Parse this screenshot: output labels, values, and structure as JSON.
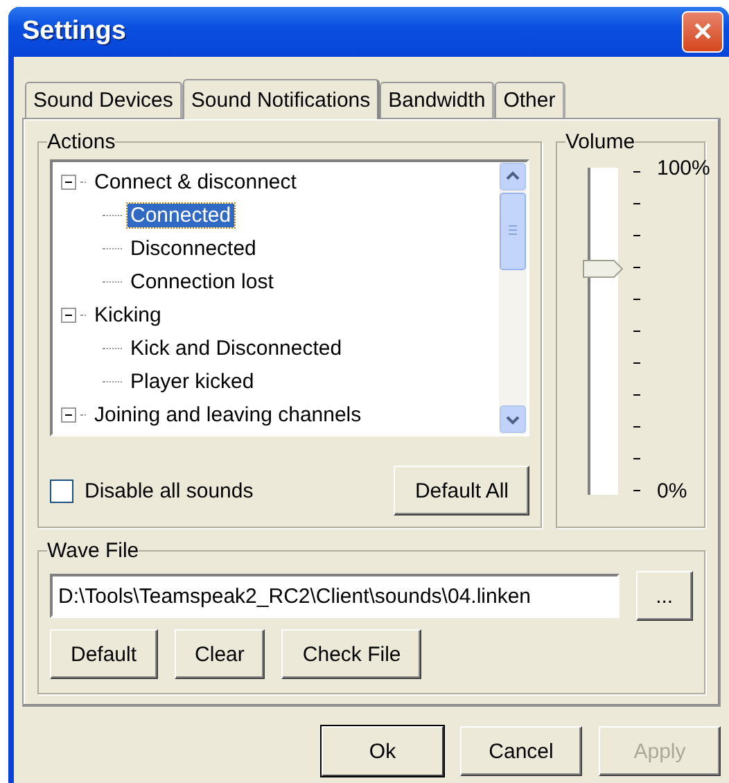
{
  "window": {
    "title": "Settings",
    "close_label": "✕"
  },
  "tabs": [
    {
      "label": "Sound Devices",
      "selected": false
    },
    {
      "label": "Sound Notifications",
      "selected": true
    },
    {
      "label": "Bandwidth",
      "selected": false
    },
    {
      "label": "Other",
      "selected": false
    }
  ],
  "actions": {
    "title": "Actions",
    "tree": [
      {
        "label": "Connect & disconnect",
        "expanded": true,
        "selected": false,
        "children": [
          {
            "label": "Connected",
            "selected": true
          },
          {
            "label": "Disconnected",
            "selected": false
          },
          {
            "label": "Connection lost",
            "selected": false
          }
        ]
      },
      {
        "label": "Kicking",
        "expanded": true,
        "selected": false,
        "children": [
          {
            "label": "Kick and Disconnected",
            "selected": false
          },
          {
            "label": "Player kicked",
            "selected": false
          }
        ]
      },
      {
        "label": "Joining and leaving  channels",
        "expanded": true,
        "selected": false
      }
    ],
    "disable_all": {
      "label": "Disable all sounds",
      "checked": false
    },
    "default_all_button": "Default All"
  },
  "volume": {
    "title": "Volume",
    "level": 0.7,
    "max_label": "100%",
    "min_label": "0%"
  },
  "wave_file": {
    "title": "Wave File",
    "value": "D:\\Tools\\Teamspeak2_RC2\\Client\\sounds\\04.linken",
    "browse_button": "...",
    "buttons": [
      "Default",
      "Clear",
      "Check File"
    ]
  },
  "footer_buttons": [
    {
      "label": "Ok",
      "default": true,
      "disabled": false
    },
    {
      "label": "Cancel",
      "default": false,
      "disabled": false
    },
    {
      "label": "Apply",
      "default": false,
      "disabled": true
    }
  ]
}
